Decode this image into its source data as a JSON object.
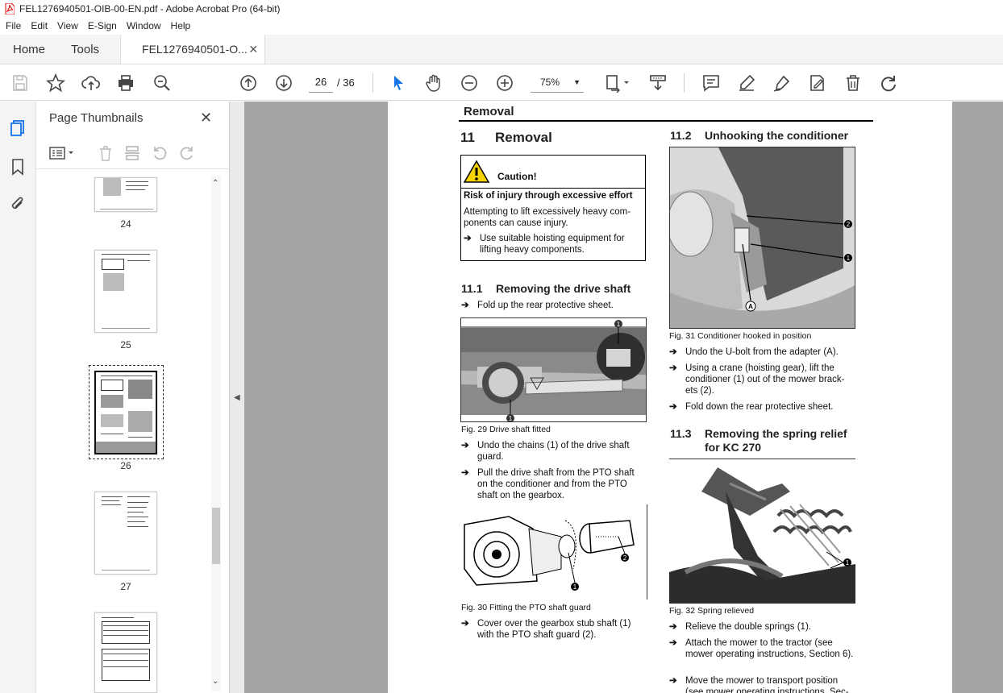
{
  "window": {
    "title": "FEL1276940501-OIB-00-EN.pdf - Adobe Acrobat Pro (64-bit)"
  },
  "menu": [
    "File",
    "Edit",
    "View",
    "E-Sign",
    "Window",
    "Help"
  ],
  "tabs": {
    "home": "Home",
    "tools": "Tools",
    "document": "FEL1276940501-O...",
    "close": "✕"
  },
  "toolbar": {
    "current_page": "26",
    "total_pages": "/ 36",
    "zoom": "75%"
  },
  "thumbnails": {
    "title": "Page Thumbnails",
    "close": "✕",
    "pages": [
      {
        "label": "24"
      },
      {
        "label": "25"
      },
      {
        "label": "26",
        "selected": true
      },
      {
        "label": "27"
      }
    ]
  },
  "document": {
    "header": "Removal",
    "section": {
      "number": "11",
      "title": "Removal"
    },
    "caution": {
      "title": "Caution!",
      "subtitle": "Risk of injury through excessive effort",
      "body": "Attempting to lift excessively heavy com-ponents can cause injury.",
      "action": "Use suitable hoisting equipment for lifting heavy components."
    },
    "s11_1": {
      "number": "11.1",
      "title": "Removing the drive shaft",
      "step1": "Fold up the rear protective sheet.",
      "fig29_caption": "Fig. 29    Drive shaft fitted",
      "step2": "Undo the chains (1) of the drive shaft guard.",
      "step3": "Pull the drive shaft from the PTO shaft on the conditioner and from the PTO shaft on the gearbox.",
      "fig30_caption": "Fig. 30    Fitting the PTO shaft guard",
      "step4": "Cover over the gearbox stub shaft (1) with the PTO shaft guard (2)."
    },
    "s11_2": {
      "number": "11.2",
      "title": "Unhooking the conditioner",
      "fig31_caption": "Fig. 31    Conditioner hooked in position",
      "step1": "Undo the U-bolt from the adapter (A).",
      "step2": "Using a crane (hoisting gear), lift the conditioner (1) out of the mower brack-ets (2).",
      "step3": "Fold down the rear protective sheet."
    },
    "s11_3": {
      "number": "11.3",
      "title_line1": "Removing the spring relief",
      "title_line2": "for KC 270",
      "fig32_caption": "Fig. 32    Spring relieved",
      "step1": "Relieve the double springs (1).",
      "step2": "Attach the mower to the tractor (see mower operating instructions, Section 6).",
      "step3": "Move the mower to transport position (see mower operating instructions, Sec-"
    },
    "callouts": {
      "one": "1",
      "two": "2",
      "a": "A"
    },
    "arrow_glyph": "➔"
  },
  "colors": {
    "accent": "#1473e6",
    "doc_background": "#a5a5a5",
    "warning_yellow": "#f5d400"
  }
}
